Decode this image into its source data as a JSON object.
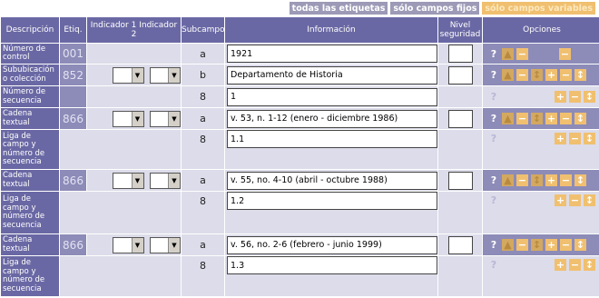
{
  "top_buttons": {
    "all": "todas las etiquetas",
    "fixed": "sólo campos fijos",
    "variable": "sólo campos variables"
  },
  "headers": {
    "desc": "Descripción",
    "etiq": "Etiq.",
    "ind1": "Indicador 1",
    "ind2": "Indicador 2",
    "sub": "Subcampo",
    "info": "Información",
    "nivel": "Nivel seguridad",
    "ops": "Opciones"
  },
  "rows": {
    "r1": {
      "desc": "Número de control",
      "etiq": "001",
      "sub": "a",
      "info": "1921"
    },
    "r2": {
      "desc": "Sububicación o colección",
      "etiq": "852",
      "sub": "b",
      "info": "Departamento de Historia"
    },
    "r3": {
      "desc": "Número de secuencia",
      "sub": "8",
      "info": "1"
    },
    "r4": {
      "desc": "Cadena textual",
      "etiq": "866",
      "sub": "a",
      "info": "v. 53, n. 1-12 (enero - diciembre 1986)"
    },
    "r5": {
      "desc": "Liga de campo y número de secuencia",
      "sub": "8",
      "info": "1.1"
    },
    "r6": {
      "desc": "Cadena textual",
      "etiq": "866",
      "sub": "a",
      "info": "v. 55, no. 4-10 (abril - octubre 1988)"
    },
    "r7": {
      "desc": "Liga de campo y número de secuencia",
      "sub": "8",
      "info": "1.2"
    },
    "r8": {
      "desc": "Cadena textual",
      "etiq": "866",
      "sub": "a",
      "info": "v. 56, no. 2-6 (febrero - junio 1999)"
    },
    "r9": {
      "desc": "Liga de campo y número de secuencia",
      "sub": "8",
      "info": "1.3"
    }
  },
  "icons": {
    "help": "?",
    "plus": "+",
    "minus": "−",
    "move": "↕",
    "up": "▲"
  },
  "colors": {
    "header": "#6a68a4",
    "row": "#dcdcea",
    "etiq": "#8d8bb8",
    "accent": "#f0c070"
  }
}
